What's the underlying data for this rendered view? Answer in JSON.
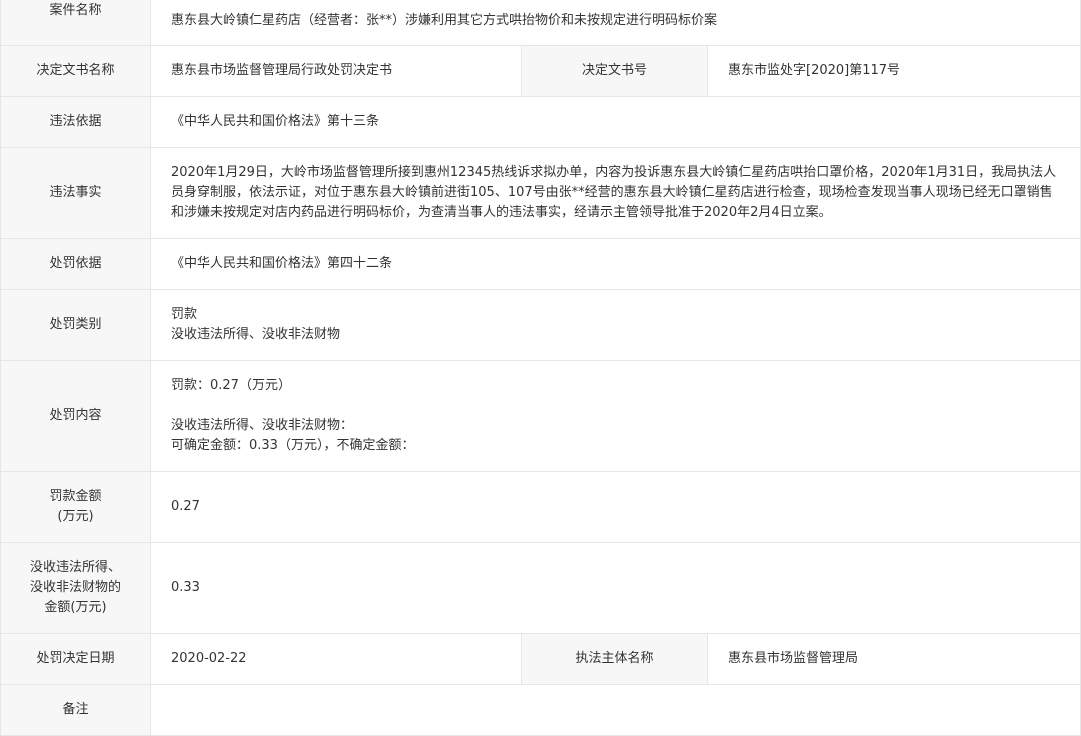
{
  "case_name": {
    "label": "案件名称",
    "value": "惠东县大岭镇仁星药店（经营者：张**）涉嫌利用其它方式哄抬物价和未按规定进行明码标价案"
  },
  "decision_doc_name": {
    "label": "决定文书名称",
    "value": "惠东县市场监督管理局行政处罚决定书"
  },
  "decision_doc_number": {
    "label": "决定文书号",
    "value": "惠东市监处字[2020]第117号"
  },
  "violation_basis": {
    "label": "违法依据",
    "value": "《中华人民共和国价格法》第十三条"
  },
  "violation_facts": {
    "label": "违法事实",
    "value": "2020年1月29日，大岭市场监督管理所接到惠州12345热线诉求拟办单，内容为投诉惠东县大岭镇仁星药店哄抬口罩价格，2020年1月31日，我局执法人员身穿制服，依法示证，对位于惠东县大岭镇前进街105、107号由张**经营的惠东县大岭镇仁星药店进行检查，现场检查发现当事人现场已经无口罩销售和涉嫌未按规定对店内药品进行明码标价，为查清当事人的违法事实，经请示主管领导批准于2020年2月4日立案。"
  },
  "penalty_basis": {
    "label": "处罚依据",
    "value": "《中华人民共和国价格法》第四十二条"
  },
  "penalty_category": {
    "label": "处罚类别",
    "lines": [
      "罚款",
      "没收违法所得、没收非法财物"
    ]
  },
  "penalty_content": {
    "label": "处罚内容",
    "fine_line": "罚款：0.27（万元）",
    "confiscation_heading": "没收违法所得、没收非法财物：",
    "confiscation_amounts": "可确定金额：0.33（万元），不确定金额："
  },
  "fine_amount": {
    "label_line1": "罚款金额",
    "label_line2": "(万元)",
    "value": "0.27"
  },
  "confiscation_amount": {
    "label_line1": "没收违法所得、",
    "label_line2": "没收非法财物的",
    "label_line3": "金额(万元)",
    "value": "0.33"
  },
  "decision_date": {
    "label": "处罚决定日期",
    "value": "2020-02-22"
  },
  "enforcement_body": {
    "label": "执法主体名称",
    "value": "惠东县市场监督管理局"
  },
  "remarks": {
    "label": "备注",
    "value": ""
  }
}
